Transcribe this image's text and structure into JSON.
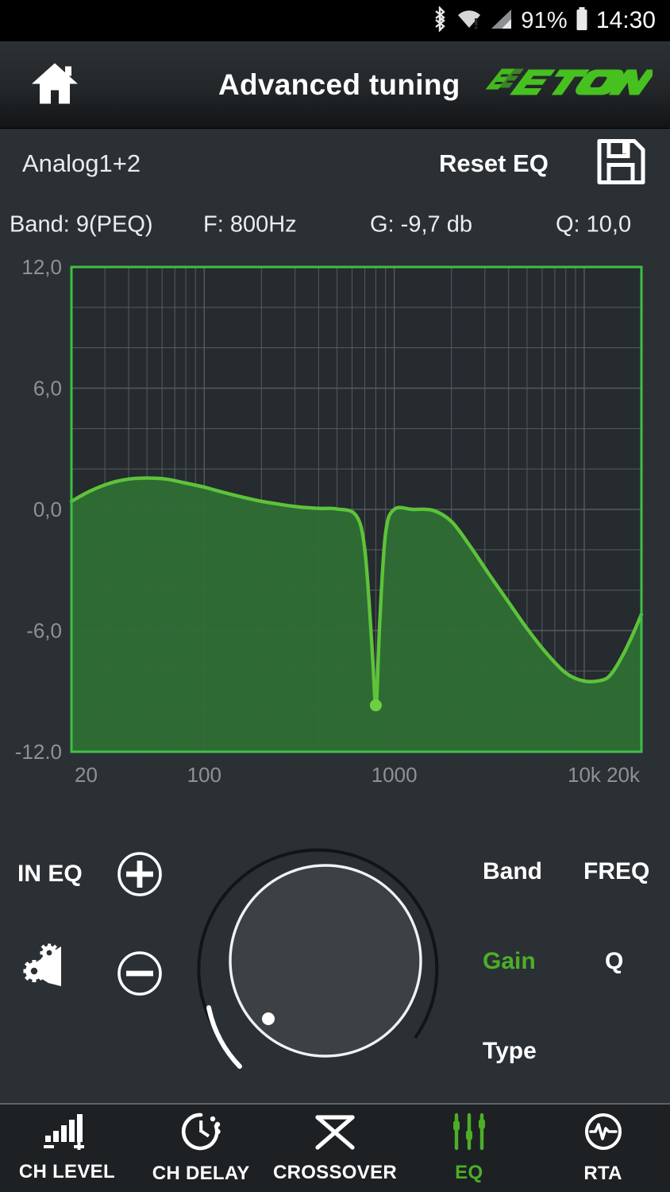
{
  "statusbar": {
    "icons": [
      "bluetooth-icon",
      "wifi-icon",
      "cellular-signal-icon",
      "battery-icon"
    ],
    "battery_percent": "91%",
    "time": "14:30"
  },
  "titlebar": {
    "home_icon": "home-icon",
    "title": "Advanced tuning",
    "brand": "ETON"
  },
  "channel_row": {
    "channel": "Analog1+2",
    "reset_label": "Reset EQ",
    "save_icon": "save-floppy-icon"
  },
  "params": {
    "band": "Band: 9(PEQ)",
    "freq": "F: 800Hz",
    "gain": "G: -9,7 db",
    "q": "Q: 10,0"
  },
  "controls": {
    "in_eq_label": "IN EQ",
    "speaker_config_icon": "speaker-settings-icon",
    "plus_icon": "plus-circle-icon",
    "minus_icon": "minus-circle-icon",
    "knob_icon": "rotary-knob",
    "selectors": [
      {
        "label": "Band",
        "active": false
      },
      {
        "label": "FREQ",
        "active": false
      },
      {
        "label": "Gain",
        "active": true
      },
      {
        "label": "Q",
        "active": false
      },
      {
        "label": "Type",
        "active": false
      }
    ]
  },
  "navbar": {
    "items": [
      {
        "label": "CH LEVEL",
        "icon": "level-bars-icon",
        "active": false
      },
      {
        "label": "CH DELAY",
        "icon": "clock-icon",
        "active": false
      },
      {
        "label": "CROSSOVER",
        "icon": "crossover-x-icon",
        "active": false
      },
      {
        "label": "EQ",
        "icon": "sliders-icon",
        "active": true
      },
      {
        "label": "RTA",
        "icon": "waveform-circle-icon",
        "active": false
      }
    ]
  },
  "colors": {
    "accent_green": "#4caf27",
    "curve_green": "#5dc33a",
    "fill_green": "#2d6b33",
    "plot_bg": "#262b2f",
    "panel_bg": "#2b3034",
    "navbar_bg": "#1d2124"
  },
  "chart_data": {
    "type": "line",
    "title": "",
    "xlabel": "",
    "ylabel": "",
    "xscale": "log",
    "xlim": [
      20,
      20000
    ],
    "ylim": [
      -12,
      12
    ],
    "xticks": [
      20,
      100,
      1000,
      10000,
      20000
    ],
    "xticklabels": [
      "20",
      "100",
      "1000",
      "10k",
      "20k"
    ],
    "yticks": [
      12,
      6,
      0,
      -6,
      -12
    ],
    "yticklabels": [
      "12,0",
      "6,0",
      "0,0",
      "-6,0",
      "-12.0"
    ],
    "grid": true,
    "legend": false,
    "filled": true,
    "series": [
      {
        "name": "EQ response",
        "x": [
          20,
          25,
          32,
          40,
          50,
          63,
          80,
          100,
          125,
          160,
          200,
          250,
          315,
          400,
          500,
          630,
          700,
          760,
          790,
          800,
          810,
          840,
          900,
          1000,
          1250,
          1600,
          2000,
          2500,
          3150,
          4000,
          5000,
          6300,
          8000,
          10000,
          12500,
          14000,
          16000,
          18000,
          20000
        ],
        "values": [
          0.4,
          0.9,
          1.3,
          1.5,
          1.55,
          1.5,
          1.3,
          1.1,
          0.85,
          0.6,
          0.4,
          0.25,
          0.12,
          0.05,
          0.02,
          -0.3,
          -2.0,
          -6.5,
          -9.3,
          -9.7,
          -9.3,
          -5.5,
          -1.2,
          0.0,
          0.0,
          -0.05,
          -0.6,
          -1.8,
          -3.2,
          -4.6,
          -5.9,
          -7.1,
          -8.1,
          -8.5,
          -8.45,
          -8.1,
          -7.2,
          -6.2,
          -5.2
        ]
      }
    ],
    "markers": [
      {
        "name": "selected-band-marker",
        "x": 800,
        "y": -9.7
      }
    ]
  }
}
